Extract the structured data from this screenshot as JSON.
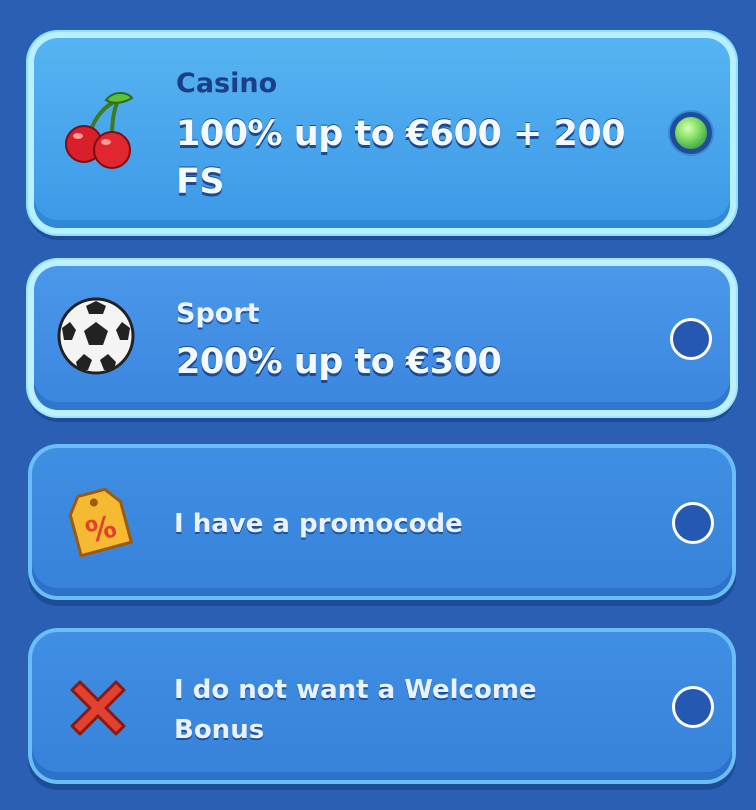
{
  "options": [
    {
      "category": "Casino",
      "headline": "100% up to €600 + 200 FS",
      "icon": "cherries-icon",
      "selected": true
    },
    {
      "category": "Sport",
      "headline": "200% up to €300",
      "icon": "soccer-ball-icon",
      "selected": false
    },
    {
      "label": "I have a promocode",
      "icon": "percent-tag-icon",
      "selected": false
    },
    {
      "label": "I do not want a Welcome Bonus",
      "icon": "red-x-icon",
      "selected": false
    }
  ],
  "colors": {
    "background": "#2a5fb4",
    "selected_radio": "#8ce36a",
    "tag": "#f5b932",
    "x_mark": "#e3412f"
  }
}
